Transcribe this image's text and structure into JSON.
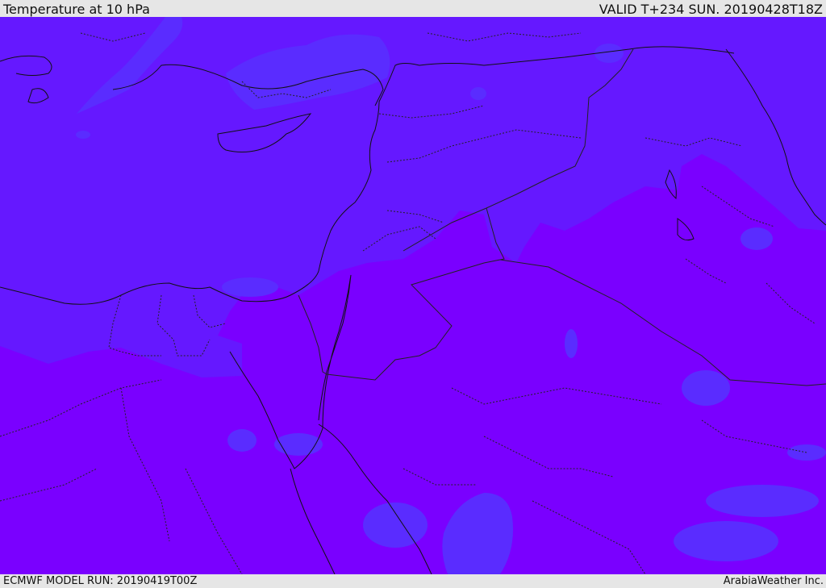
{
  "header": {
    "title": "Temperature at 10 hPa",
    "valid": "VALID T+234 SUN. 20190428T18Z"
  },
  "footer": {
    "model_run": "ECMWF MODEL RUN: 20190419T00Z",
    "credit": "ArabiaWeather Inc."
  },
  "map": {
    "field": "Temperature at 10 hPa",
    "colors": {
      "cool_band": "#6518ff",
      "patch": "#5a2cff",
      "warm_band": "#7a00ff",
      "coastline": "#111111",
      "border": "#222222"
    }
  }
}
